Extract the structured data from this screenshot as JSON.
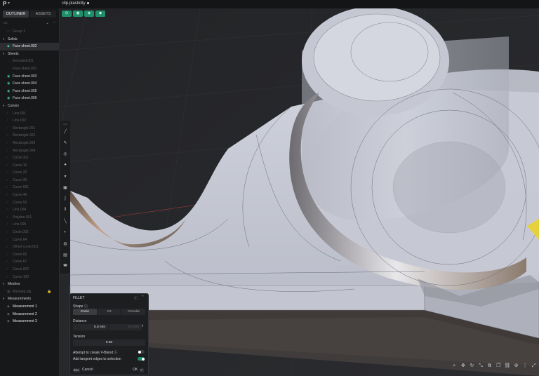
{
  "window": {
    "logo": "P",
    "file_name": "clip.plasticity"
  },
  "sidebar": {
    "tabs": [
      "OUTLINER",
      "ASSETS"
    ],
    "items": [
      {
        "kind": "item",
        "label": "Group 1",
        "icon": "folder-icon",
        "state": "dim"
      },
      {
        "kind": "group",
        "label": "Solids",
        "icon": "chevron-down-icon"
      },
      {
        "kind": "item",
        "label": "Face sheet.002",
        "icon": "solid-icon",
        "state": "sel"
      },
      {
        "kind": "group",
        "label": "Sheets",
        "icon": "chevron-down-icon"
      },
      {
        "kind": "item",
        "label": "Extruded.001",
        "icon": "eye-off-icon",
        "state": "dim"
      },
      {
        "kind": "item",
        "label": "Face sheet.001",
        "icon": "eye-off-icon",
        "state": "dim"
      },
      {
        "kind": "item",
        "label": "Face sheet.003",
        "icon": "eye-icon",
        "state": "vis"
      },
      {
        "kind": "item",
        "label": "Face sheet.004",
        "icon": "eye-icon",
        "state": "vis"
      },
      {
        "kind": "item",
        "label": "Face sheet.005",
        "icon": "eye-icon",
        "state": "vis"
      },
      {
        "kind": "item",
        "label": "Face sheet.006",
        "icon": "eye-icon",
        "state": "vis"
      },
      {
        "kind": "group",
        "label": "Curves",
        "icon": "chevron-down-icon"
      },
      {
        "kind": "item",
        "label": "Line.001",
        "icon": "curve-icon",
        "state": "dim"
      },
      {
        "kind": "item",
        "label": "Line.002",
        "icon": "curve-icon",
        "state": "dim"
      },
      {
        "kind": "item",
        "label": "Rectangle.001",
        "icon": "curve-icon",
        "state": "dim"
      },
      {
        "kind": "item",
        "label": "Rectangle.002",
        "icon": "curve-icon",
        "state": "dim"
      },
      {
        "kind": "item",
        "label": "Rectangle.003",
        "icon": "curve-icon",
        "state": "dim"
      },
      {
        "kind": "item",
        "label": "Rectangle.004",
        "icon": "curve-icon",
        "state": "dim"
      },
      {
        "kind": "item",
        "label": "Circle.001",
        "icon": "curve-icon",
        "state": "dim"
      },
      {
        "kind": "item",
        "label": "Curve.10",
        "icon": "curve-icon",
        "state": "dim"
      },
      {
        "kind": "item",
        "label": "Curve.20",
        "icon": "curve-icon",
        "state": "dim"
      },
      {
        "kind": "item",
        "label": "Curve.30",
        "icon": "curve-icon",
        "state": "dim"
      },
      {
        "kind": "item",
        "label": "Curve.001",
        "icon": "curve-icon",
        "state": "dim"
      },
      {
        "kind": "item",
        "label": "Curve.40",
        "icon": "curve-icon",
        "state": "dim"
      },
      {
        "kind": "item",
        "label": "Curve.50",
        "icon": "curve-icon",
        "state": "dim"
      },
      {
        "kind": "item",
        "label": "Line.004",
        "icon": "curve-icon",
        "state": "dim"
      },
      {
        "kind": "item",
        "label": "Polyline.001",
        "icon": "curve-icon",
        "state": "dim"
      },
      {
        "kind": "item",
        "label": "Line.005",
        "icon": "curve-icon",
        "state": "dim"
      },
      {
        "kind": "item",
        "label": "Circle.002",
        "icon": "curve-icon",
        "state": "dim"
      },
      {
        "kind": "item",
        "label": "Curve.64",
        "icon": "curve-icon",
        "state": "dim"
      },
      {
        "kind": "item",
        "label": "Offset curve.001",
        "icon": "curve-icon",
        "state": "dim"
      },
      {
        "kind": "item",
        "label": "Curve.66",
        "icon": "curve-icon",
        "state": "dim"
      },
      {
        "kind": "item",
        "label": "Curve.67",
        "icon": "curve-icon",
        "state": "dim"
      },
      {
        "kind": "item",
        "label": "Curve.002",
        "icon": "curve-icon",
        "state": "dim"
      },
      {
        "kind": "item",
        "label": "Curve.100",
        "icon": "curve-icon",
        "state": "dim"
      },
      {
        "kind": "group",
        "label": "Meshes",
        "icon": "chevron-down-icon"
      },
      {
        "kind": "item",
        "label": "Working.obj",
        "icon": "mesh-icon",
        "state": "dim",
        "locked": true
      },
      {
        "kind": "group",
        "label": "Measurements",
        "icon": "chevron-down-icon"
      },
      {
        "kind": "item",
        "label": "Measurement 1",
        "icon": "measure-icon",
        "state": "lit"
      },
      {
        "kind": "item",
        "label": "Measurement 2",
        "icon": "measure-icon",
        "state": "lit"
      },
      {
        "kind": "item",
        "label": "Measurement 3",
        "icon": "measure-icon",
        "state": "lit"
      }
    ]
  },
  "fillet": {
    "title": "FILLET",
    "shape_label": "Shape",
    "shape_options": [
      "Conic",
      "G2",
      "Chordal"
    ],
    "shape_selected": "Conic",
    "distance_label": "Distance",
    "distance_value": "0.0 mm",
    "distance_placeholder": "0.0 mm",
    "tension_label": "Tension",
    "tension_value": "0.50",
    "vblend_label": "Attempt to create V-Blend",
    "vblend_on": false,
    "tangent_label": "Add tangent edges to selection",
    "tangent_on": true,
    "cancel_key": "Esc",
    "cancel_label": "Cancel",
    "ok_label": "OK",
    "ok_key": "↵"
  },
  "colors": {
    "accent": "#1f8f6a",
    "selection_green": "#3ec292",
    "background": "#252628",
    "model_surface": "#c7cad6"
  }
}
